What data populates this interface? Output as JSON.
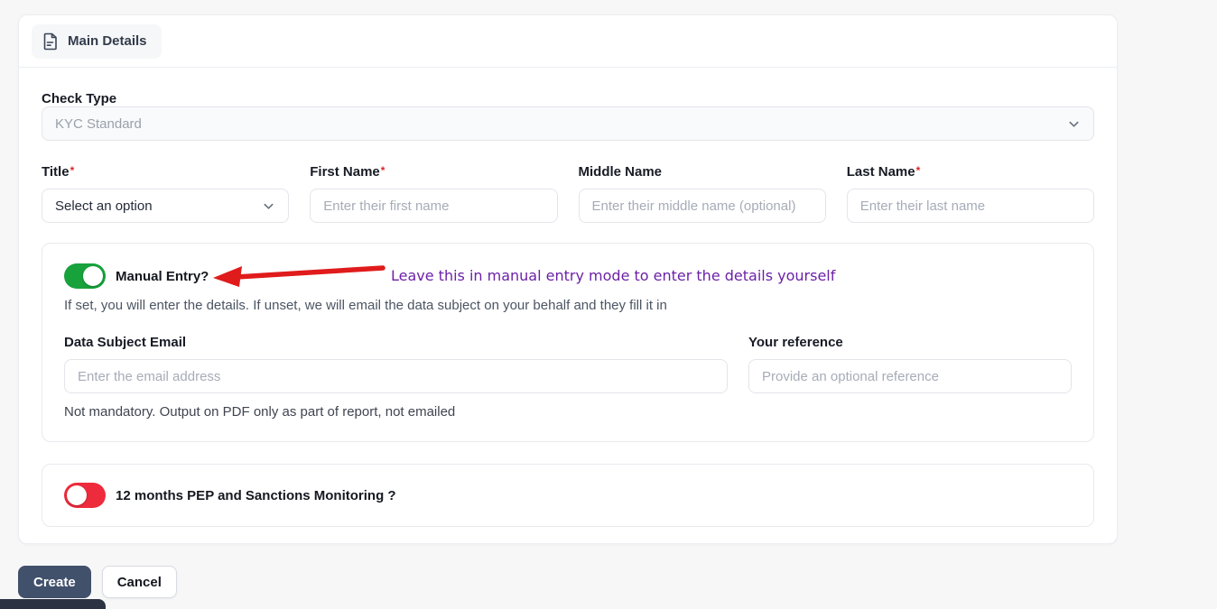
{
  "header": {
    "tab_label": "Main Details"
  },
  "misc": {
    "required_marker": "*"
  },
  "check_type": {
    "label": "Check Type",
    "selected_value": "KYC Standard"
  },
  "person_fields": {
    "title": {
      "label": "Title",
      "selected_value": "Select an option"
    },
    "first_name": {
      "label": "First Name",
      "placeholder": "Enter their first name"
    },
    "middle_name": {
      "label": "Middle Name",
      "placeholder": "Enter their middle name (optional)"
    },
    "last_name": {
      "label": "Last Name",
      "placeholder": "Enter their last name"
    }
  },
  "manual_entry": {
    "toggle_label": "Manual Entry?",
    "toggle_state": "on",
    "annotation_text": "Leave this in manual entry mode to enter the details yourself",
    "description": "If set, you will enter the details. If unset, we will email the data subject on your behalf and they fill it in",
    "email": {
      "label": "Data Subject Email",
      "placeholder": "Enter the email address",
      "helper": "Not mandatory. Output on PDF only as part of report, not emailed"
    },
    "reference": {
      "label": "Your reference",
      "placeholder": "Provide an optional reference"
    }
  },
  "monitoring": {
    "toggle_label": "12 months PEP and Sanctions Monitoring ?",
    "toggle_state": "off"
  },
  "actions": {
    "create_label": "Create",
    "cancel_label": "Cancel"
  },
  "colors": {
    "toggle_on_green": "#17a23c",
    "toggle_off_red": "#ee2b3c",
    "annotation_purple": "#6c21a8",
    "arrow_red": "#e01b1b",
    "create_button_bg": "#42516b",
    "required_red": "#dc2626"
  }
}
